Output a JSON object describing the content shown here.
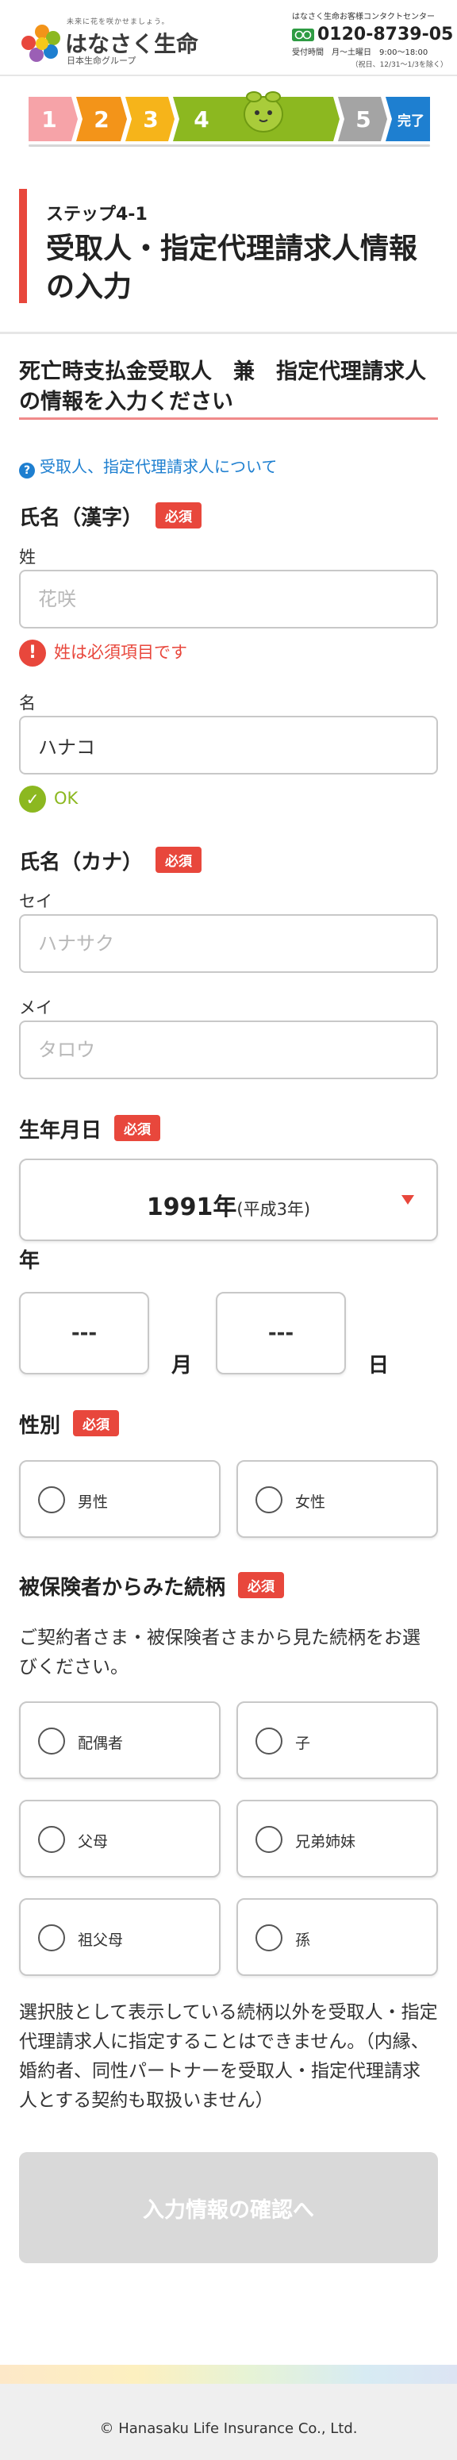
{
  "header": {
    "tagline": "未来に花を咲かせましょう。",
    "brand": "はなさく生命",
    "group": "日本生命グループ",
    "contact_title": "はなさく生命お客様コンタクトセンター",
    "freedial_label": "フリーダイヤル",
    "phone": "0120-8739-05",
    "hours": "受付時間　月～土曜日　9:00～18:00",
    "hours_note": "（祝日、12/31～1/3を除く）"
  },
  "progress": {
    "steps": [
      {
        "label": "1",
        "color": "#f6a3a8"
      },
      {
        "label": "2",
        "color": "#f39419"
      },
      {
        "label": "3",
        "color": "#f6b41a"
      },
      {
        "label": "4",
        "color": "#8cb820"
      },
      {
        "label": "5",
        "color": "#a4a4a4"
      },
      {
        "label": "完了",
        "color": "#1e7fd0"
      }
    ],
    "current_step": 4
  },
  "title": {
    "step": "ステップ4-1",
    "main": "受取人・指定代理請求人情報の入力"
  },
  "section_heading": "死亡時支払金受取人　兼　指定代理請求人の情報を入力ください",
  "help_link": "受取人、指定代理請求人について",
  "required_label": "必須",
  "name_kanji": {
    "label": "氏名（漢字）",
    "last_label": "姓",
    "last_placeholder": "花咲",
    "last_value": "",
    "error": "姓は必須項目です",
    "first_label": "名",
    "first_value": "ハナコ",
    "ok": "OK"
  },
  "name_kana": {
    "label": "氏名（カナ）",
    "last_label": "セイ",
    "last_placeholder": "ハナサク",
    "first_label": "メイ",
    "first_placeholder": "タロウ"
  },
  "birthdate": {
    "label": "生年月日",
    "year_value": "1991年",
    "year_era": "(平成3年)",
    "year_suffix": "年",
    "month_value": "---",
    "month_suffix": "月",
    "day_value": "---",
    "day_suffix": "日"
  },
  "gender": {
    "label": "性別",
    "options": [
      "男性",
      "女性"
    ]
  },
  "relation": {
    "label": "被保険者からみた続柄",
    "description": "ご契約者さま・被保険者さまから見た続柄をお選びください。",
    "options": [
      "配偶者",
      "子",
      "父母",
      "兄弟姉妹",
      "祖父母",
      "孫"
    ],
    "note": "選択肢として表示している続柄以外を受取人・指定代理請求人に指定することはできません。（内縁、婚約者、同性パートナーを受取人・指定代理請求人とする契約も取扱いません）"
  },
  "submit_label": "入力情報の確認へ",
  "footer": {
    "copyright": "© Hanasaku Life Insurance Co., Ltd."
  },
  "colors": {
    "accent_red": "#e8473c",
    "ok_green": "#8cb820",
    "link_blue": "#1e7fd0"
  }
}
